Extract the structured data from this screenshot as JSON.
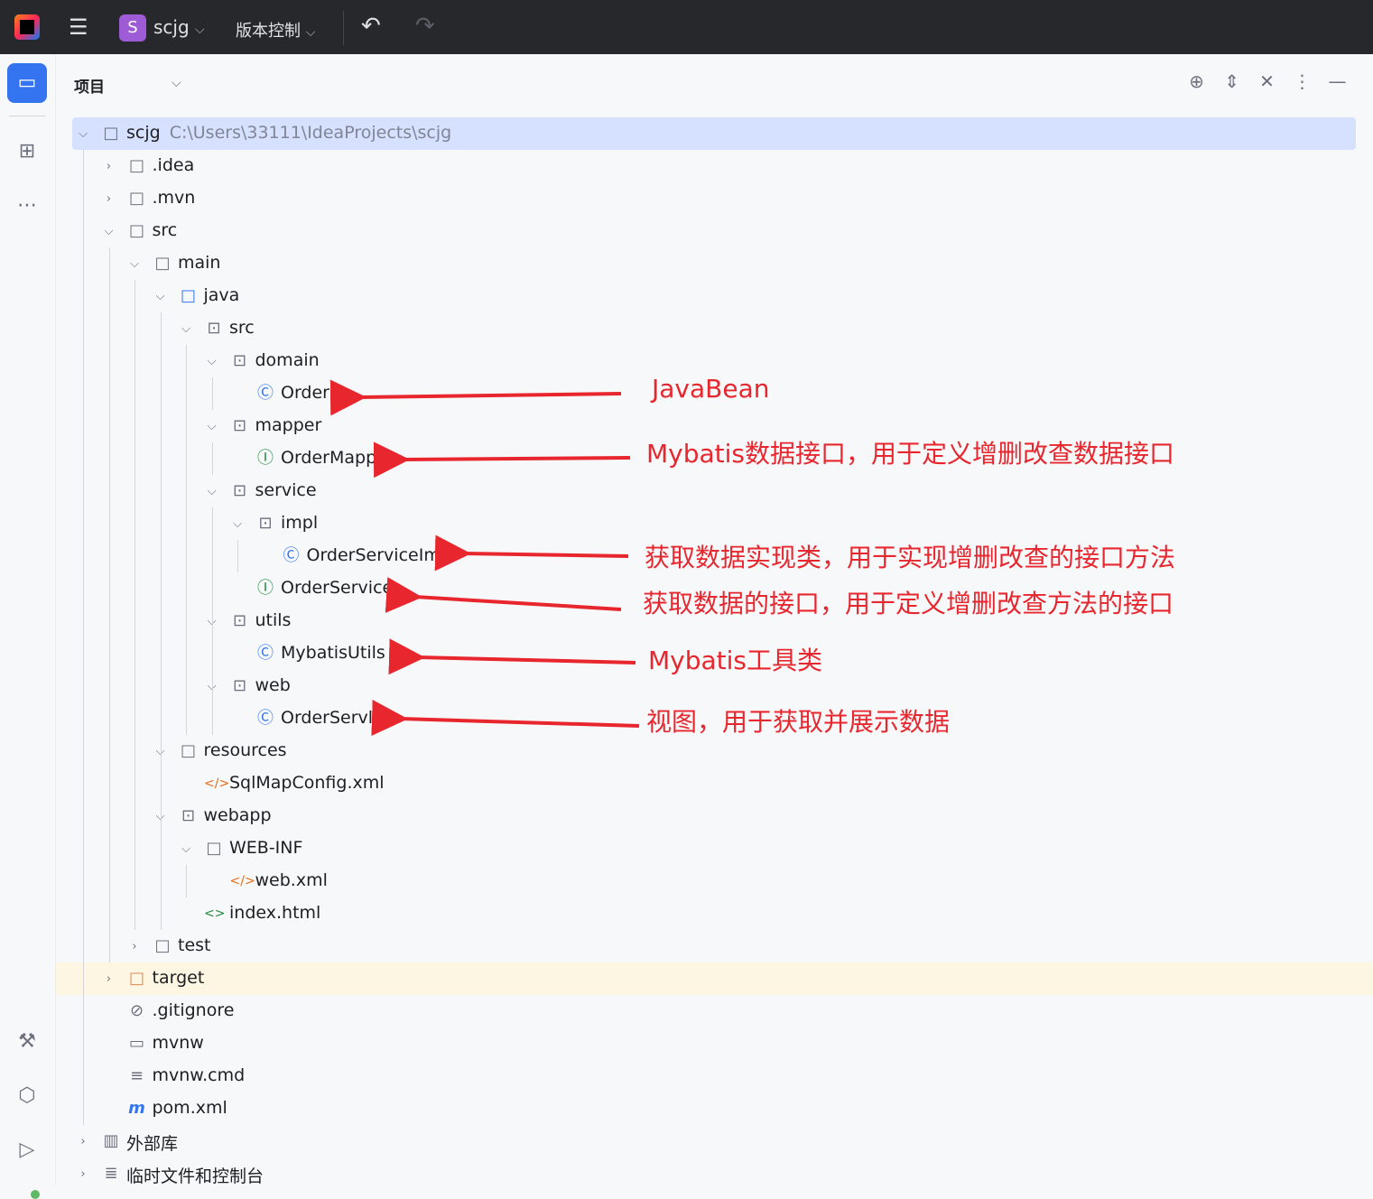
{
  "topbar": {
    "project_badge": "S",
    "project_name": "scjg",
    "vcs_label": "版本控制",
    "undo_icon": "undo-icon",
    "redo_icon": "redo-icon"
  },
  "panel": {
    "title": "项目"
  },
  "tree": [
    {
      "label": "scjg",
      "path": "C:\\Users\\33111\\IdeaProjects\\scjg"
    },
    {
      "label": ".idea"
    },
    {
      "label": ".mvn"
    },
    {
      "label": "src"
    },
    {
      "label": "main"
    },
    {
      "label": "java"
    },
    {
      "label": "src"
    },
    {
      "label": "domain"
    },
    {
      "label": "Order"
    },
    {
      "label": "mapper"
    },
    {
      "label": "OrderMapper"
    },
    {
      "label": "service"
    },
    {
      "label": "impl"
    },
    {
      "label": "OrderServiceImpl"
    },
    {
      "label": "OrderService"
    },
    {
      "label": "utils"
    },
    {
      "label": "MybatisUtils"
    },
    {
      "label": "web"
    },
    {
      "label": "OrderServlet"
    },
    {
      "label": "resources"
    },
    {
      "label": "SqlMapConfig.xml"
    },
    {
      "label": "webapp"
    },
    {
      "label": "WEB-INF"
    },
    {
      "label": "web.xml"
    },
    {
      "label": "index.html"
    },
    {
      "label": "test"
    },
    {
      "label": "target"
    },
    {
      "label": ".gitignore"
    },
    {
      "label": "mvnw"
    },
    {
      "label": "mvnw.cmd"
    },
    {
      "label": "pom.xml"
    },
    {
      "label": "外部库"
    },
    {
      "label": "临时文件和控制台"
    }
  ],
  "annotations": [
    "JavaBean",
    "Mybatis数据接口，用于定义增删改查数据接口",
    "获取数据实现类，用于实现增删改查的接口方法",
    "获取数据的接口，用于定义增删改查方法的接口",
    "Mybatis工具类",
    "视图，用于获取并展示数据"
  ],
  "colors": {
    "annotation": "#e8262e",
    "selection": "#d5e1ff",
    "accent": "#3574f0"
  }
}
